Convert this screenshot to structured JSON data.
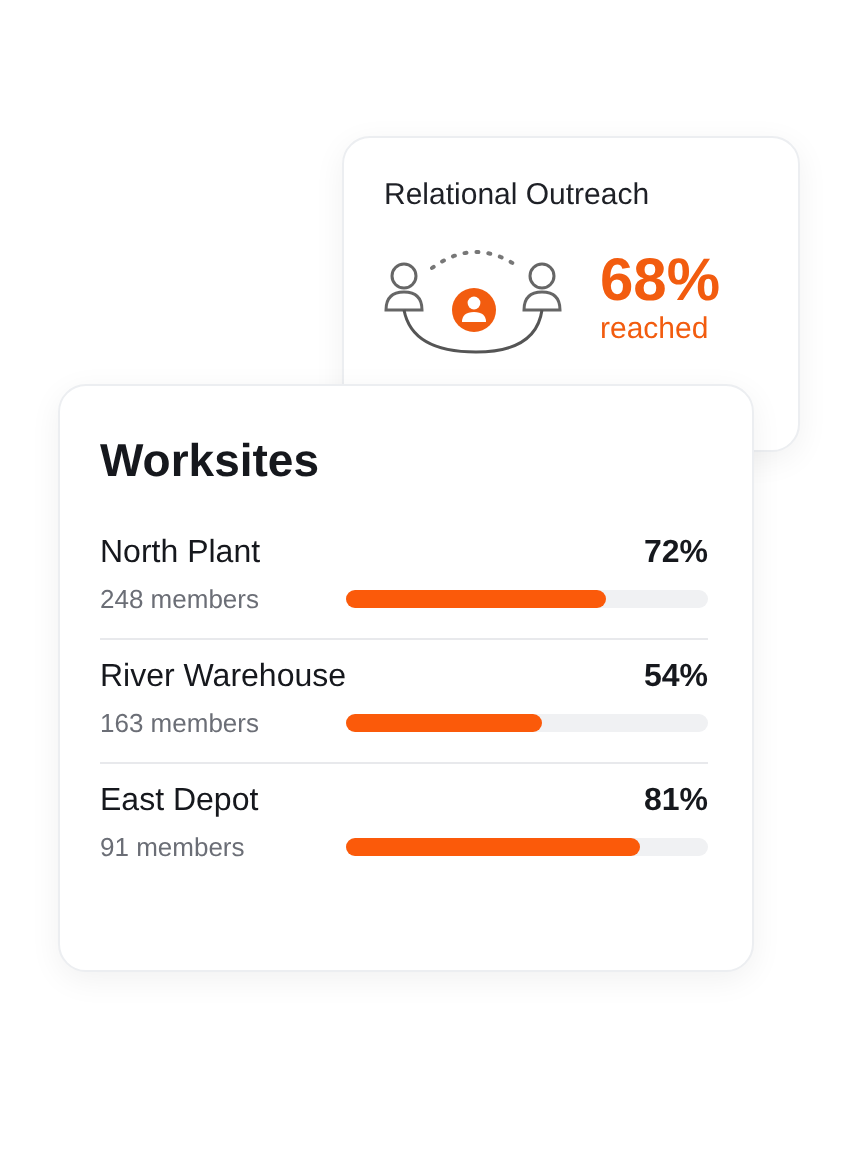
{
  "outreach": {
    "title": "Relational Outreach",
    "percent": "68%",
    "caption": "reached"
  },
  "worksites": {
    "title": "Worksites",
    "rows": [
      {
        "name": "North Plant",
        "members": "248 members",
        "percent": "72%",
        "level": 0.72
      },
      {
        "name": "River Warehouse",
        "members": "163 members",
        "percent": "54%",
        "level": 0.54
      },
      {
        "name": "East Depot",
        "members": "91 members",
        "percent": "81%",
        "level": 0.81
      }
    ]
  }
}
